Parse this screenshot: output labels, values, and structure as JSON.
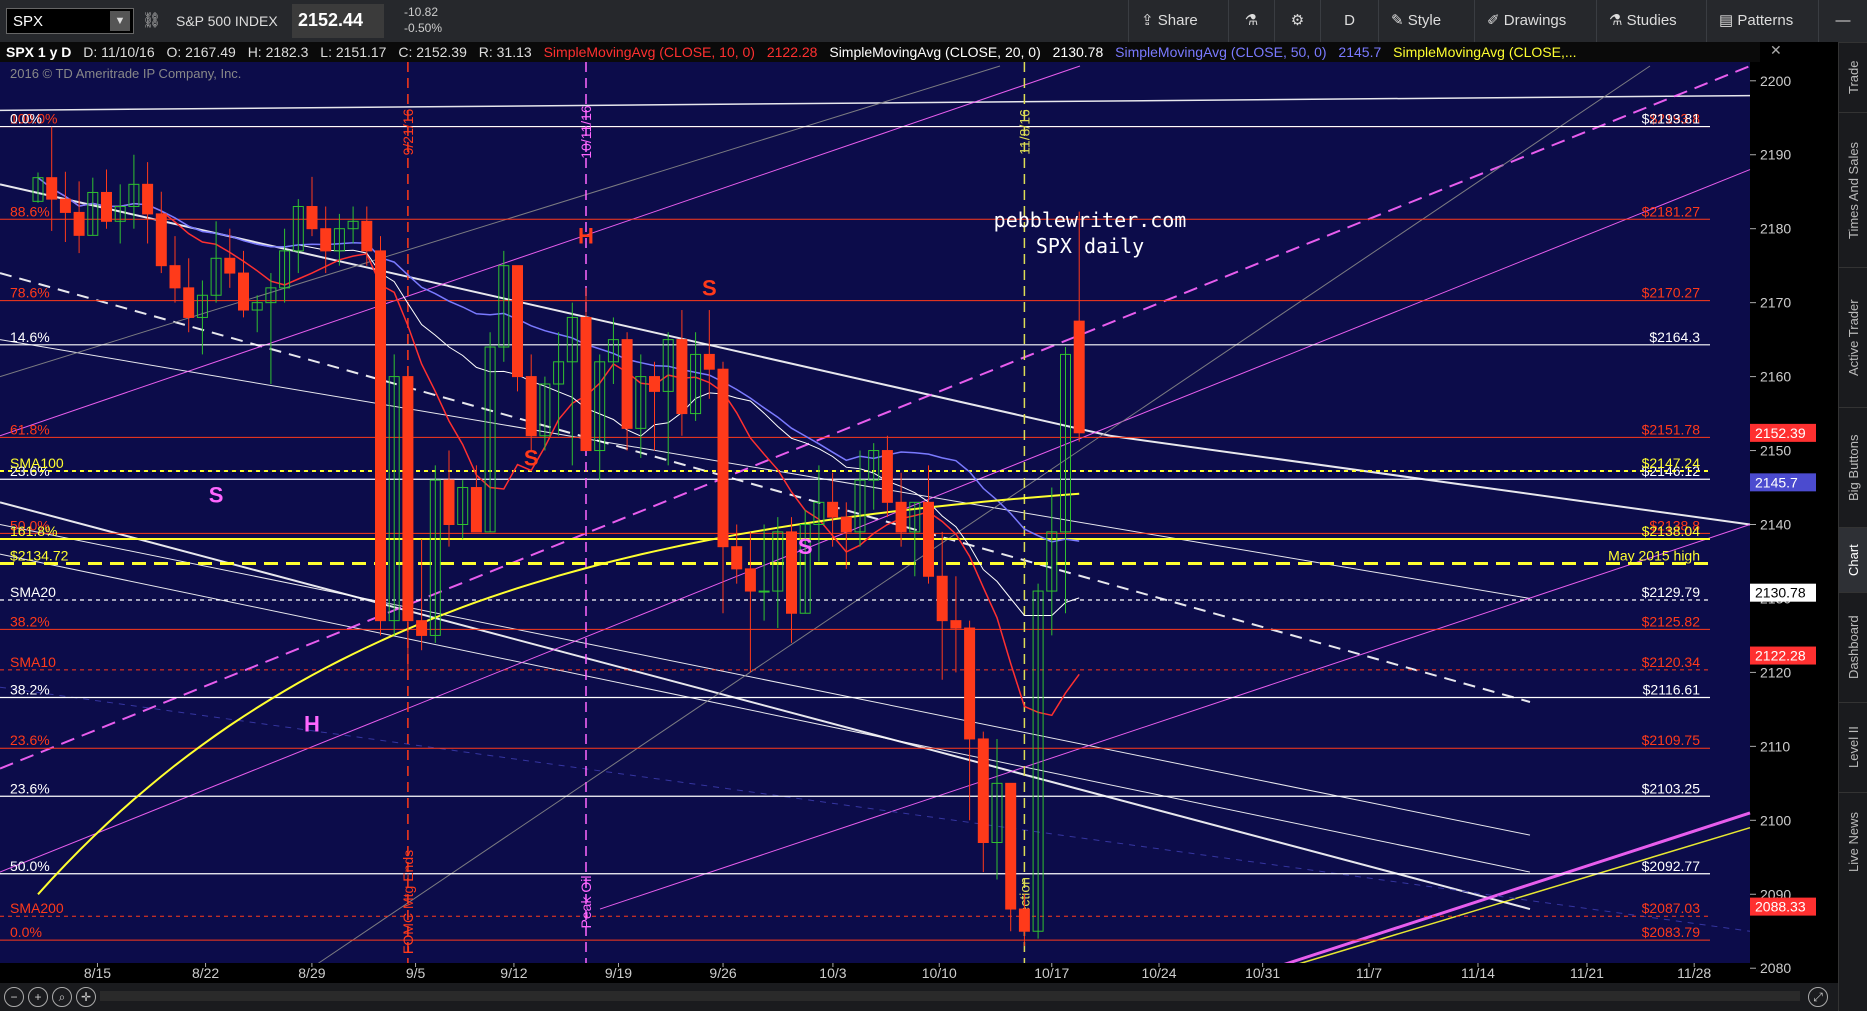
{
  "toolbar": {
    "symbol": "SPX",
    "index_name": "S&P 500 INDEX",
    "price": "2152.44",
    "change": "-10.82",
    "change_pct": "-0.50%",
    "buttons": [
      "Share",
      "D",
      "Style",
      "Drawings",
      "Studies",
      "Patterns"
    ]
  },
  "header": {
    "title": "SPX 1 y D",
    "date": "D: 11/10/16",
    "open": "O: 2167.49",
    "high": "H: 2182.3",
    "low": "L: 2151.17",
    "close": "C: 2152.39",
    "range": "R: 31.13",
    "studies": [
      {
        "label": "SimpleMovingAvg (CLOSE, 10, 0)",
        "value": "2122.28",
        "color": "#ff3030"
      },
      {
        "label": "SimpleMovingAvg (CLOSE, 20, 0)",
        "value": "2130.78",
        "color": "#ffffff"
      },
      {
        "label": "SimpleMovingAvg (CLOSE, 50, 0)",
        "value": "2145.7",
        "color": "#7a7aff"
      },
      {
        "label": "SimpleMovingAvg (CLOSE,...",
        "value": "",
        "color": "#ffff30"
      }
    ]
  },
  "right_tabs": [
    "Trade",
    "Times And Sales",
    "Active Trader",
    "Big Buttons",
    "Chart",
    "Dashboard",
    "Level II",
    "Live News"
  ],
  "chart_data": {
    "type": "candlestick",
    "copyright": "2016 © TD Ameritrade IP Company, Inc.",
    "watermark": [
      "pebblewriter.com",
      "SPX daily"
    ],
    "ylim": [
      2078,
      2202
    ],
    "y_ticks": [
      2080,
      2090,
      2100,
      2110,
      2120,
      2130,
      2140,
      2150,
      2160,
      2170,
      2180,
      2190,
      2200
    ],
    "x_dates": [
      "8/15",
      "8/22",
      "8/29",
      "9/5",
      "9/12",
      "9/19",
      "9/26",
      "10/3",
      "10/10",
      "10/17",
      "10/24",
      "10/31",
      "11/7",
      "11/14",
      "11/21",
      "11/28"
    ],
    "price_tags": [
      {
        "value": 2152.39,
        "text": "2152.39",
        "color": "#ff3030"
      },
      {
        "value": 2145.7,
        "text": "2145.7",
        "color": "#4b4bcf"
      },
      {
        "value": 2130.78,
        "text": "2130.78",
        "color": "#ffffff"
      },
      {
        "value": 2122.28,
        "text": "2122.28",
        "color": "#ff3030"
      },
      {
        "value": 2088.33,
        "text": "2088.33",
        "color": "#ff3030"
      }
    ],
    "white_levels": [
      {
        "value": 2193.81,
        "text": "$2193.81",
        "left": "0.0%"
      },
      {
        "value": 2164.3,
        "text": "$2164.3",
        "left": "14.6%"
      },
      {
        "value": 2146.12,
        "text": "$2146.12",
        "left": "23.6%"
      },
      {
        "value": 2129.79,
        "text": "$2129.79",
        "left": "SMA20"
      },
      {
        "value": 2116.61,
        "text": "$2116.61",
        "left": "38.2%"
      },
      {
        "value": 2103.25,
        "text": "$2103.25",
        "left": "23.6%"
      },
      {
        "value": 2092.77,
        "text": "$2092.77",
        "left": "50.0%"
      }
    ],
    "red_levels": [
      {
        "value": 2193.8,
        "text": "$2193.8",
        "left": "100.0%"
      },
      {
        "value": 2181.27,
        "text": "$2181.27",
        "left": "88.6%"
      },
      {
        "value": 2170.27,
        "text": "$2170.27",
        "left": "78.6%"
      },
      {
        "value": 2151.78,
        "text": "$2151.78",
        "left": "61.8%"
      },
      {
        "value": 2138.8,
        "text": "$2138.8",
        "left": "50.0%"
      },
      {
        "value": 2125.82,
        "text": "$2125.82",
        "left": "38.2%"
      },
      {
        "value": 2120.34,
        "text": "$2120.34",
        "left": "SMA10"
      },
      {
        "value": 2109.75,
        "text": "$2109.75",
        "left": "23.6%"
      },
      {
        "value": 2087.03,
        "text": "$2087.03",
        "left": "SMA200"
      },
      {
        "value": 2083.79,
        "text": "$2083.79",
        "left": "0.0%"
      }
    ],
    "yellow_levels": [
      {
        "value": 2147.24,
        "text": "$2147.24",
        "left": "SMA100"
      },
      {
        "value": 2138.04,
        "text": "$2138.04",
        "left": "161.8%"
      },
      {
        "value": 2134.72,
        "text": "May 2015 high",
        "left": "$2134.72"
      }
    ],
    "vlines": [
      {
        "date": "9/21/16",
        "label_top": "9/21/16",
        "label_bottom": "FOMC Mtg Ends",
        "color": "#ff3a1a"
      },
      {
        "date": "10/11/16",
        "label_top": "10/11/16",
        "label_bottom": "Peak Oil",
        "color": "#ff66ff"
      },
      {
        "date": "11/8/16",
        "label_top": "11/8/16",
        "label_bottom": "Election",
        "color": "#dddd55"
      }
    ],
    "pattern_labels": [
      {
        "text": "H",
        "color": "#ff3a1a"
      },
      {
        "text": "S",
        "color": "#ff3a1a"
      },
      {
        "text": "S",
        "color": "#ff3a1a"
      },
      {
        "text": "S",
        "color": "#ff66ff"
      },
      {
        "text": "S",
        "color": "#ff66ff"
      },
      {
        "text": "H",
        "color": "#ff66ff"
      }
    ],
    "series": [
      {
        "name": "SPX",
        "ohlc": [
          [
            2183.7,
            2187.6,
            2183.5,
            2186.9
          ],
          [
            2186.9,
            2193.8,
            2179.7,
            2184.0
          ],
          [
            2184.0,
            2187.7,
            2178.2,
            2182.2
          ],
          [
            2182.2,
            2186.4,
            2176.7,
            2179.1
          ],
          [
            2179.1,
            2186.9,
            2179.1,
            2184.9
          ],
          [
            2184.9,
            2188.0,
            2180.0,
            2181.0
          ],
          [
            2181.0,
            2186.0,
            2178.0,
            2183.0
          ],
          [
            2183.0,
            2190.0,
            2180.0,
            2186.0
          ],
          [
            2186.0,
            2189.0,
            2178.0,
            2182.0
          ],
          [
            2182.0,
            2185.0,
            2174.0,
            2175.0
          ],
          [
            2175.0,
            2179.0,
            2170.0,
            2172.0
          ],
          [
            2172.0,
            2176.0,
            2166.0,
            2168.0
          ],
          [
            2168.0,
            2173.0,
            2163.0,
            2171.0
          ],
          [
            2171.0,
            2181.0,
            2170.0,
            2176.0
          ],
          [
            2176.0,
            2180.0,
            2172.0,
            2174.0
          ],
          [
            2174.0,
            2177.0,
            2168.0,
            2169.0
          ],
          [
            2169.0,
            2171.0,
            2166.0,
            2170.0
          ],
          [
            2170.0,
            2174.0,
            2159.0,
            2172.0
          ],
          [
            2172.0,
            2180.0,
            2170.0,
            2177.0
          ],
          [
            2177.0,
            2184.0,
            2174.0,
            2183.0
          ],
          [
            2183.0,
            2187.0,
            2179.0,
            2180.0
          ],
          [
            2180.0,
            2183.0,
            2174.0,
            2177.0
          ],
          [
            2177.0,
            2182.0,
            2175.0,
            2180.0
          ],
          [
            2180.0,
            2183.0,
            2178.0,
            2181.0
          ],
          [
            2181.0,
            2183.0,
            2175.0,
            2177.0
          ],
          [
            2177.0,
            2179.0,
            2125.0,
            2127.0
          ],
          [
            2127.0,
            2163.0,
            2125.0,
            2160.0
          ],
          [
            2160.0,
            2161.0,
            2119.0,
            2127.0
          ],
          [
            2127.0,
            2138.0,
            2123.0,
            2125.0
          ],
          [
            2125.0,
            2148.0,
            2124.0,
            2146.0
          ],
          [
            2146.0,
            2150.0,
            2137.0,
            2140.0
          ],
          [
            2140.0,
            2146.0,
            2138.0,
            2145.0
          ],
          [
            2145.0,
            2148.0,
            2139.0,
            2139.0
          ],
          [
            2139.0,
            2166.0,
            2139.0,
            2164.0
          ],
          [
            2164.0,
            2177.0,
            2162.0,
            2175.0
          ],
          [
            2175.0,
            2175.0,
            2158.0,
            2160.0
          ],
          [
            2160.0,
            2163.0,
            2150.0,
            2152.0
          ],
          [
            2152.0,
            2160.0,
            2150.0,
            2159.0
          ],
          [
            2159.0,
            2166.0,
            2152.0,
            2162.0
          ],
          [
            2162.0,
            2170.0,
            2148.0,
            2168.0
          ],
          [
            2168.0,
            2172.0,
            2150.0,
            2150.0
          ],
          [
            2150.0,
            2163.0,
            2146.0,
            2162.0
          ],
          [
            2162.0,
            2168.0,
            2159.0,
            2165.0
          ],
          [
            2165.0,
            2166.0,
            2150.0,
            2153.0
          ],
          [
            2153.0,
            2163.0,
            2149.0,
            2160.0
          ],
          [
            2160.0,
            2162.0,
            2150.0,
            2158.0
          ],
          [
            2158.0,
            2166.0,
            2148.0,
            2165.0
          ],
          [
            2165.0,
            2169.0,
            2152.0,
            2155.0
          ],
          [
            2155.0,
            2166.0,
            2154.0,
            2163.0
          ],
          [
            2163.0,
            2169.0,
            2157.0,
            2161.0
          ],
          [
            2161.0,
            2162.0,
            2128.0,
            2137.0
          ],
          [
            2137.0,
            2140.0,
            2132.0,
            2134.0
          ],
          [
            2134.0,
            2139.0,
            2120.0,
            2131.0
          ],
          [
            2131.0,
            2140.0,
            2127.0,
            2131.0
          ],
          [
            2131.0,
            2141.0,
            2126.0,
            2139.0
          ],
          [
            2139.0,
            2141.0,
            2124.0,
            2128.0
          ],
          [
            2128.0,
            2142.0,
            2128.0,
            2140.0
          ],
          [
            2140.0,
            2148.0,
            2135.0,
            2143.0
          ],
          [
            2143.0,
            2147.0,
            2137.0,
            2141.0
          ],
          [
            2141.0,
            2143.0,
            2134.0,
            2139.0
          ],
          [
            2139.0,
            2150.0,
            2137.0,
            2146.0
          ],
          [
            2146.0,
            2151.0,
            2142.0,
            2150.0
          ],
          [
            2150.0,
            2152.0,
            2141.0,
            2143.0
          ],
          [
            2143.0,
            2147.0,
            2137.0,
            2139.0
          ],
          [
            2139.0,
            2143.0,
            2133.0,
            2143.0
          ],
          [
            2143.0,
            2148.0,
            2132.0,
            2133.0
          ],
          [
            2133.0,
            2139.0,
            2119.0,
            2127.0
          ],
          [
            2127.0,
            2133.0,
            2120.0,
            2126.0
          ],
          [
            2126.0,
            2127.0,
            2100.0,
            2111.0
          ],
          [
            2111.0,
            2112.0,
            2093.0,
            2097.0
          ],
          [
            2097.0,
            2111.0,
            2092.0,
            2105.0
          ],
          [
            2105.0,
            2105.0,
            2085.0,
            2088.0
          ],
          [
            2088.0,
            2090.0,
            2083.0,
            2085.0
          ],
          [
            2085.0,
            2132.0,
            2084.0,
            2131.0
          ],
          [
            2131.0,
            2145.0,
            2125.0,
            2139.0
          ],
          [
            2139.0,
            2164.0,
            2128.0,
            2163.0
          ],
          [
            2167.5,
            2182.3,
            2151.2,
            2152.4
          ]
        ]
      },
      {
        "name": "SMA10",
        "color": "#ff3030"
      },
      {
        "name": "SMA20",
        "color": "#ffffff"
      },
      {
        "name": "SMA50",
        "color": "#7a7aff"
      },
      {
        "name": "SMA100",
        "color": "#ffff30"
      }
    ],
    "grid": true
  }
}
